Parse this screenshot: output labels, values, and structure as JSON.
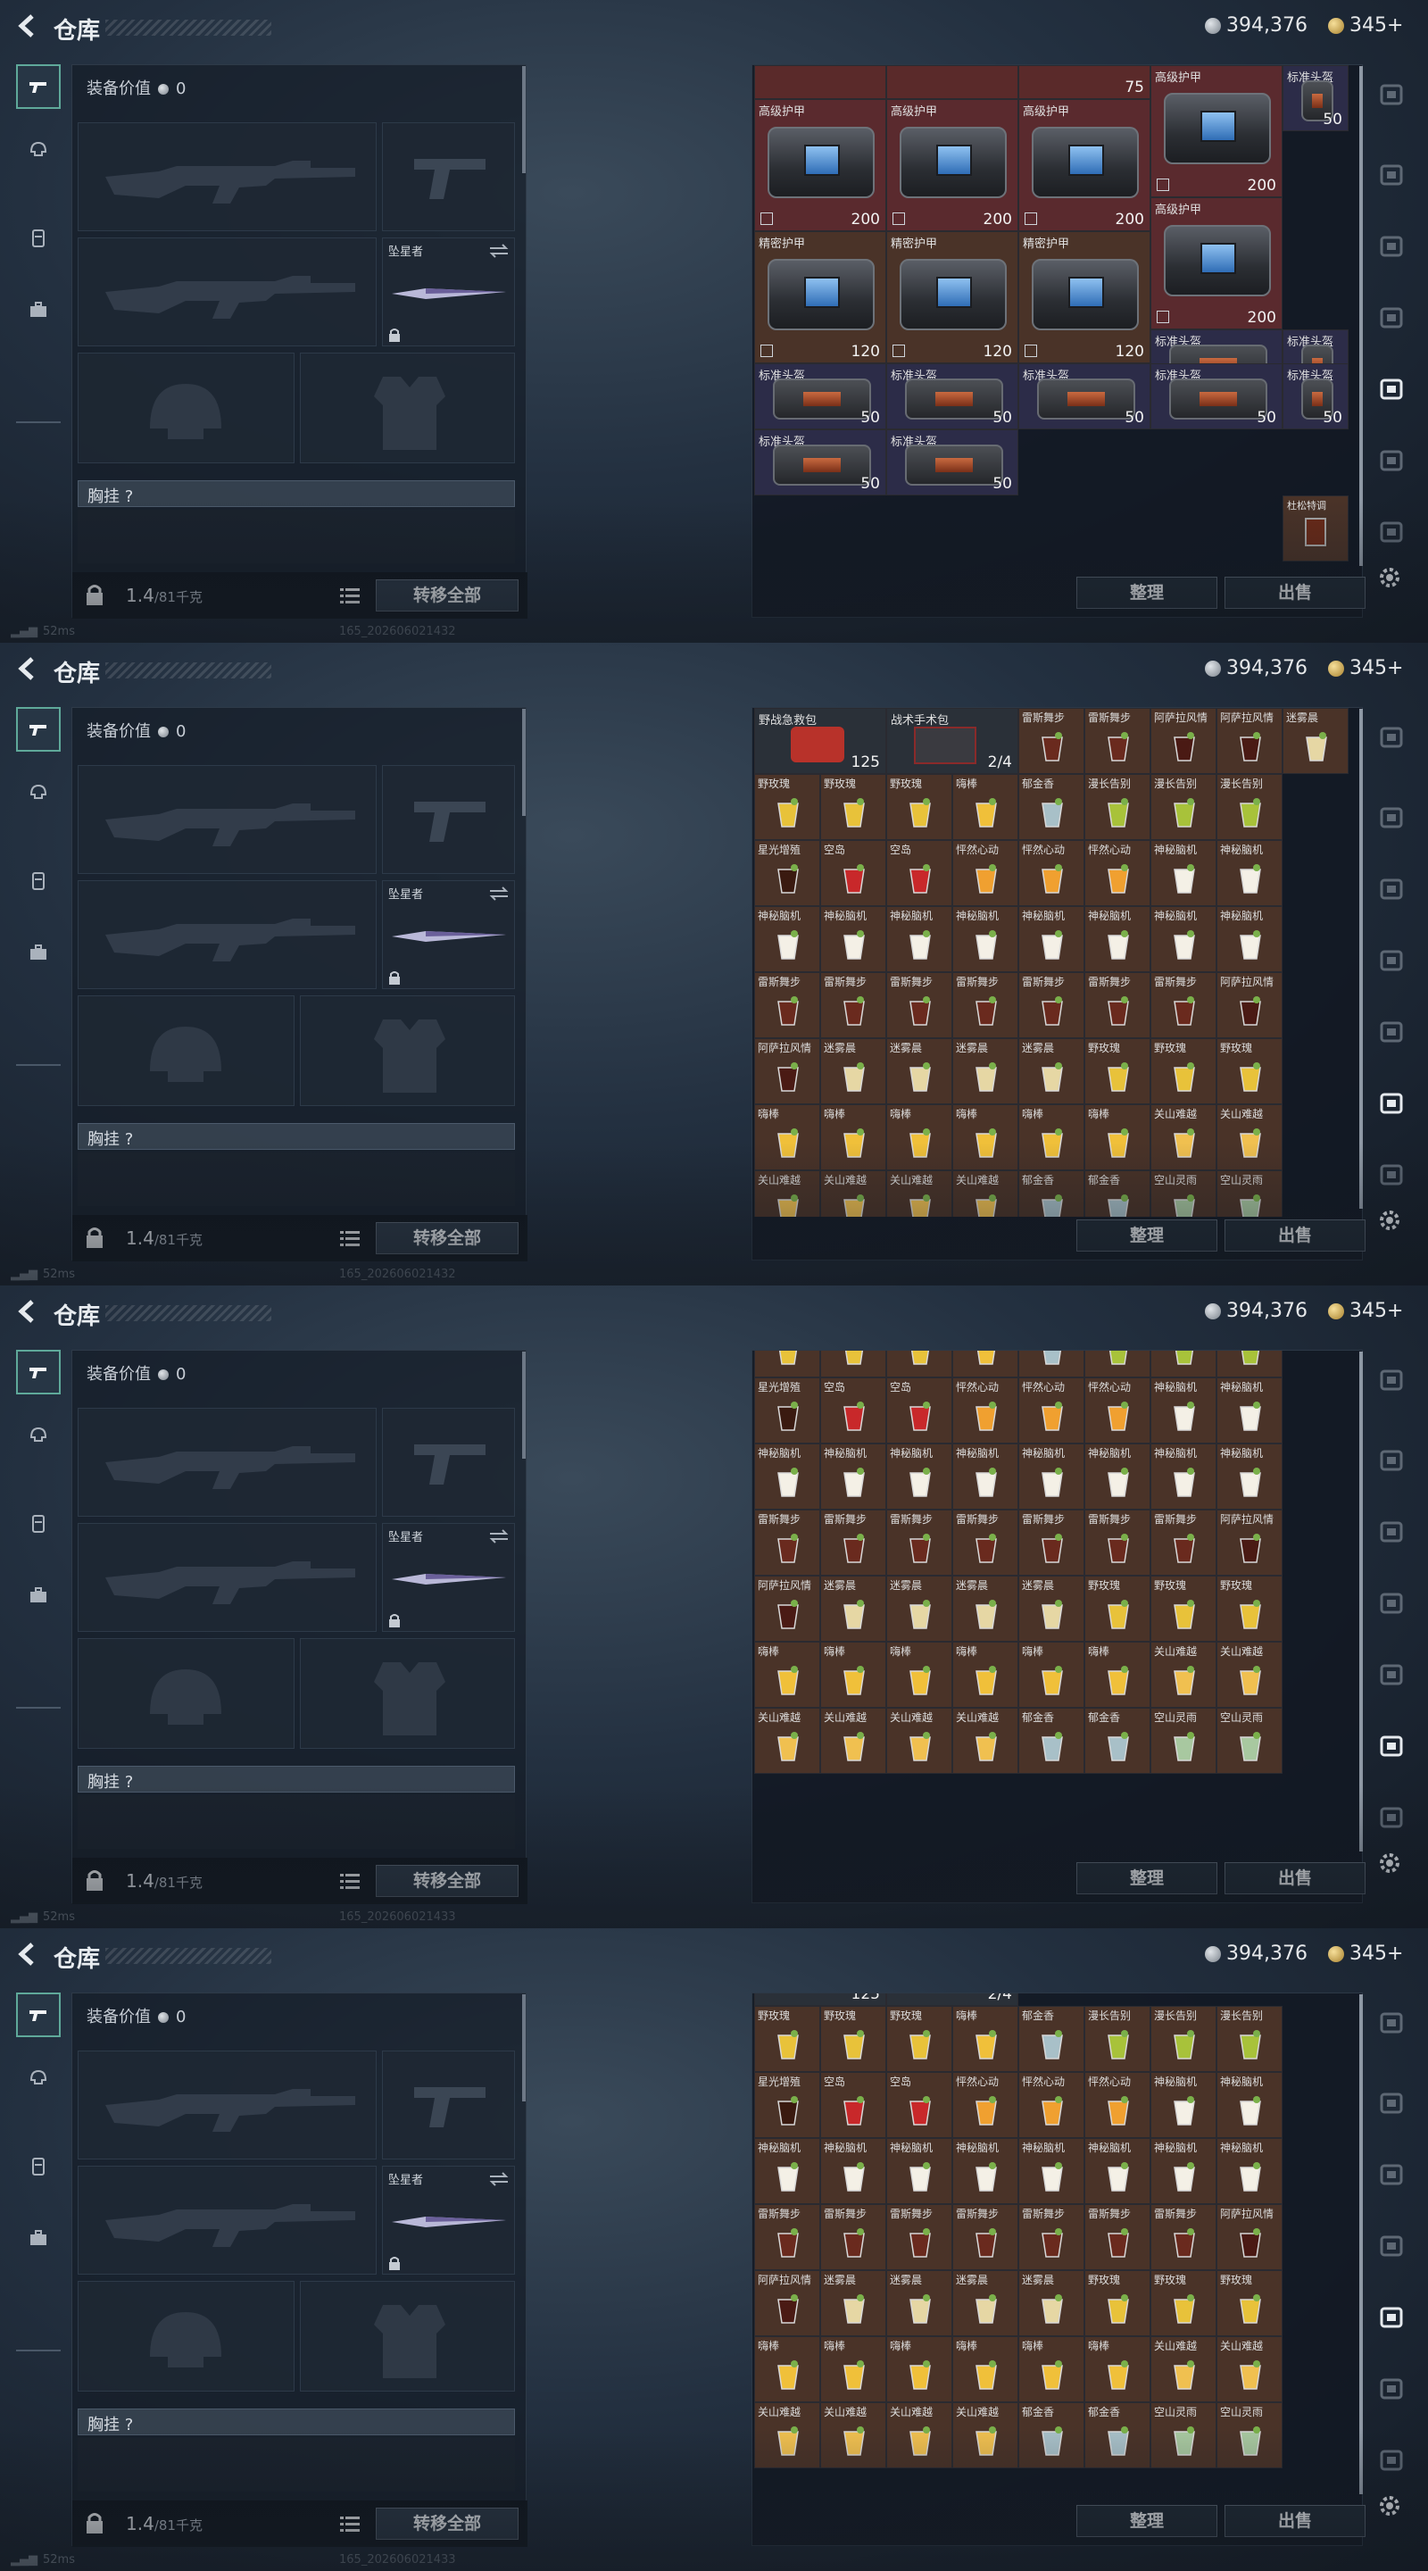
{
  "header": {
    "title": "仓库",
    "silver": "394,376",
    "gold": "345+"
  },
  "loadout": {
    "equip_value_label": "装备价值",
    "equip_value": "0",
    "melee_name": "坠星者",
    "chest_label": "胸挂 ?",
    "weight": "1.4",
    "weight_max": "/81千克",
    "transfer_label": "转移全部"
  },
  "stash": {
    "sort_label": "整理",
    "sell_label": "出售"
  },
  "status": {
    "ping": "52ms",
    "builds": [
      "165_202606021432",
      "165_202606021432",
      "165_202606021433",
      "165_202606021433"
    ]
  },
  "frames": [
    {
      "type": "armor",
      "top_row": [
        "",
        "",
        "75",
        "75"
      ],
      "cells": [
        {
          "label": "高级护甲",
          "count": "200",
          "kind": "armor"
        },
        {
          "label": "高级护甲",
          "count": "200",
          "kind": "armor"
        },
        {
          "label": "高级护甲",
          "count": "200",
          "kind": "armor"
        },
        {
          "label": "高级护甲",
          "count": "200",
          "kind": "armor"
        },
        {
          "label": "高级护甲",
          "count": "200",
          "kind": "armor"
        },
        {
          "label": "精密护甲",
          "count": "120",
          "kind": "armor"
        },
        {
          "label": "精密护甲",
          "count": "120",
          "kind": "armor"
        },
        {
          "label": "精密护甲",
          "count": "120",
          "kind": "armor"
        },
        {
          "label": "标准头盔",
          "count": "50",
          "kind": "helmet"
        },
        {
          "label": "标准头盔",
          "count": "50",
          "kind": "helmet"
        },
        {
          "label": "标准头盔",
          "count": "50",
          "kind": "helmet"
        },
        {
          "label": "标准头盔",
          "count": "50",
          "kind": "helmet"
        },
        {
          "label": "标准头盔",
          "count": "50",
          "kind": "helmet"
        },
        {
          "label": "标准头盔",
          "count": "50",
          "kind": "helmet"
        },
        {
          "label": "标准头盔",
          "count": "50",
          "kind": "helmet"
        },
        {
          "label": "标准头盔",
          "count": "50",
          "kind": "helmet"
        },
        {
          "label": "标准头盔",
          "count": "50",
          "kind": "helmet"
        },
        {
          "label": "标准头盔",
          "count": "50",
          "kind": "helmet"
        },
        {
          "label": "杜松特调",
          "count": "",
          "kind": "drink"
        }
      ]
    }
  ],
  "drink_grid": {
    "first_frame_top": {
      "medkit": "野战急救包",
      "medkit_count": "125",
      "surgery": "战术手术包",
      "surgery_count": "2/4"
    },
    "rows": [
      [
        "雷斯舞步",
        "雷斯舞步",
        "阿萨拉风情",
        "阿萨拉风情",
        "迷雾晨"
      ],
      [
        "野玫瑰",
        "野玫瑰",
        "野玫瑰",
        "嗨棒",
        "郁金香",
        "漫长告别",
        "漫长告别",
        "漫长告别"
      ],
      [
        "星光增殖",
        "空岛",
        "空岛",
        "怦然心动",
        "怦然心动",
        "怦然心动",
        "神秘脑机",
        "神秘脑机"
      ],
      [
        "神秘脑机",
        "神秘脑机",
        "神秘脑机",
        "神秘脑机",
        "神秘脑机",
        "神秘脑机",
        "神秘脑机",
        "神秘脑机"
      ],
      [
        "雷斯舞步",
        "雷斯舞步",
        "雷斯舞步",
        "雷斯舞步",
        "雷斯舞步",
        "雷斯舞步",
        "雷斯舞步",
        "阿萨拉风情"
      ],
      [
        "阿萨拉风情",
        "迷雾晨",
        "迷雾晨",
        "迷雾晨",
        "迷雾晨",
        "野玫瑰",
        "野玫瑰",
        "野玫瑰"
      ],
      [
        "嗨棒",
        "嗨棒",
        "嗨棒",
        "嗨棒",
        "嗨棒",
        "嗨棒",
        "关山难越",
        "关山难越"
      ],
      [
        "关山难越",
        "关山难越",
        "关山难越",
        "关山难越",
        "郁金香",
        "郁金香",
        "空山灵雨",
        "空山灵雨"
      ]
    ]
  },
  "icons": {
    "back": "back-arrow-icon",
    "silver": "silver-coin-icon",
    "gold": "gold-coin-icon",
    "gear": "gear-icon"
  }
}
